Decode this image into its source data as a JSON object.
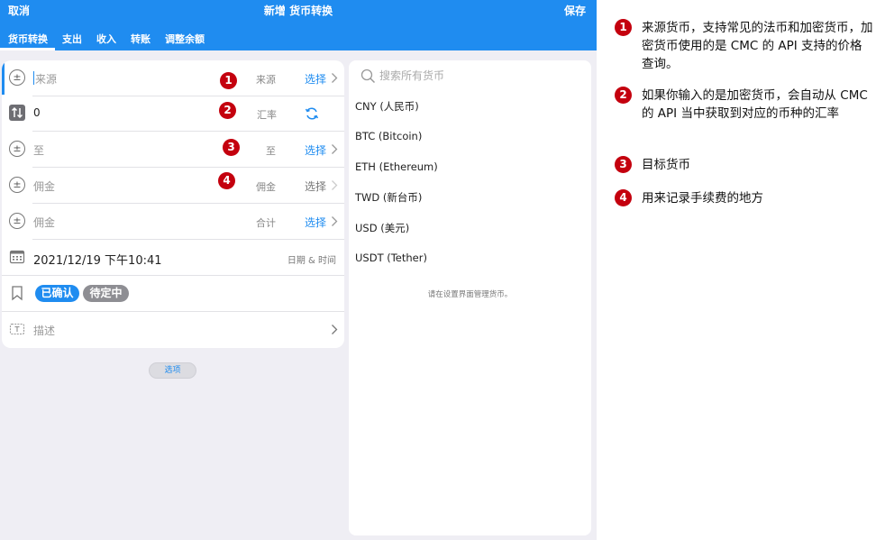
{
  "topbar": {
    "cancel": "取消",
    "title": "新增 货币转换",
    "save": "保存"
  },
  "tabs": [
    {
      "label": "货币转换",
      "active": true
    },
    {
      "label": "支出"
    },
    {
      "label": "收入"
    },
    {
      "label": "转账"
    },
    {
      "label": "调整余额"
    }
  ],
  "form": {
    "source": {
      "placeholder": "来源",
      "label": "来源",
      "action": "选择"
    },
    "rate": {
      "value": "0",
      "label": "汇率"
    },
    "target": {
      "placeholder": "至",
      "label": "至",
      "action": "选择"
    },
    "commission": {
      "placeholder": "佣金",
      "label": "佣金",
      "action": "选择"
    },
    "total": {
      "placeholder": "佣金",
      "label": "合计",
      "action": "选择"
    },
    "datetime": {
      "value": "2021/12/19 下午10:41",
      "label": "日期 & 时间"
    },
    "status": {
      "confirmed": "已确认",
      "pending": "待定中"
    },
    "description": {
      "placeholder": "描述"
    }
  },
  "markers": [
    "1",
    "2",
    "3",
    "4"
  ],
  "options_button": "选项",
  "currency_panel": {
    "search_placeholder": "搜索所有货币",
    "currencies": [
      "CNY (人民币)",
      "BTC (Bitcoin)",
      "ETH (Ethereum)",
      "TWD (新台币)",
      "USD (美元)",
      "USDT (Tether)"
    ],
    "hint": "请在设置界面管理货币。"
  },
  "annotations": [
    {
      "num": "1",
      "text": "来源货币，支持常见的法币和加密货币，加密货币使用的是 CMC 的 API 支持的价格查询。"
    },
    {
      "num": "2",
      "text": "如果你输入的是加密货币，会自动从 CMC 的 API 当中获取到对应的币种的汇率"
    },
    {
      "num": "3",
      "text": "目标货币"
    },
    {
      "num": "4",
      "text": "用来记录手续费的地方"
    }
  ],
  "colors": {
    "accent": "#1f8cf0",
    "marker": "#c4000e",
    "badge_pending": "#8e8e93"
  }
}
